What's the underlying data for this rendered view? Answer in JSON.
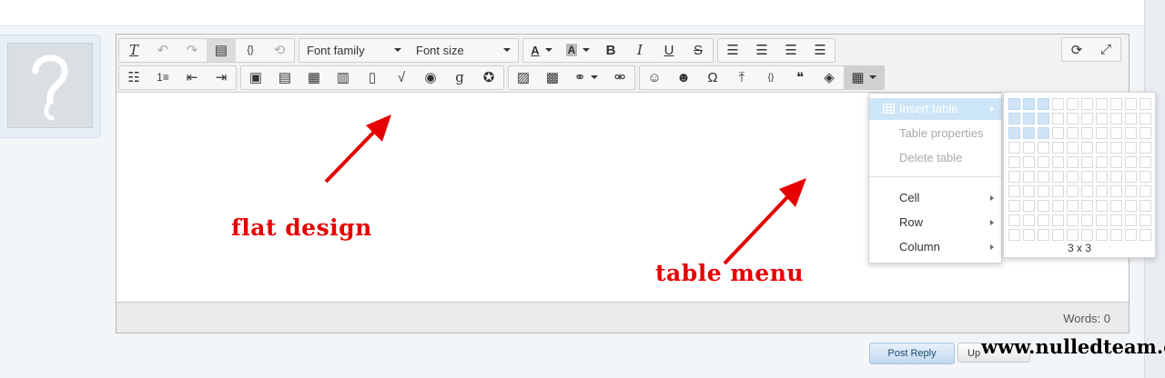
{
  "toolbar": {
    "font_family": "Font family",
    "font_size": "Font size"
  },
  "annotations": {
    "flat_design": "flat design",
    "table_menu": "table menu"
  },
  "status": {
    "words": "Words: 0"
  },
  "table_menu": {
    "items": [
      {
        "label": "Insert table",
        "state": "selected",
        "submenu": true
      },
      {
        "label": "Table properties",
        "state": "disabled",
        "submenu": false
      },
      {
        "label": "Delete table",
        "state": "disabled",
        "submenu": false
      },
      {
        "label": "Cell",
        "state": "normal",
        "submenu": true
      },
      {
        "label": "Row",
        "state": "normal",
        "submenu": true
      },
      {
        "label": "Column",
        "state": "normal",
        "submenu": true
      }
    ]
  },
  "table_grid": {
    "columns": 10,
    "rows": 10,
    "selected_cols": 3,
    "selected_rows": 3,
    "label": "3 x 3"
  },
  "buttons": {
    "post_reply": "Post Reply",
    "upload": "Up"
  },
  "watermark": "www.nulledteam.com",
  "colors": {
    "annotation": "#e60000",
    "menu_highlight": "#cde6f7"
  }
}
